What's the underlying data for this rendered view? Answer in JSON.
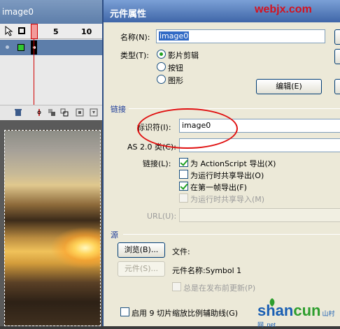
{
  "timeline": {
    "title": "image0",
    "ruler": [
      "1",
      "5",
      "10"
    ]
  },
  "dialog": {
    "title": "元件属性",
    "watermark_top": "webjx.com",
    "name_label": "名称(N):",
    "name_value": "image0",
    "type_label": "类型(T):",
    "type_options": [
      "影片剪辑",
      "按钮",
      "图形"
    ],
    "type_selected": "影片剪辑",
    "edit_button": "编辑(E)",
    "linkage_header": "链接",
    "identifier_label": "标识符(I):",
    "identifier_value": "image0",
    "as_class_label": "AS 2.0 类(C):",
    "as_class_value": "",
    "linkage_label": "链接(L):",
    "linkage_options": [
      {
        "label": "为 ActionScript 导出(X)",
        "checked": true,
        "enabled": true
      },
      {
        "label": "为运行时共享导出(O)",
        "checked": false,
        "enabled": true
      },
      {
        "label": "在第一帧导出(F)",
        "checked": true,
        "enabled": true
      },
      {
        "label": "为运行时共享导入(M)",
        "checked": false,
        "enabled": false
      }
    ],
    "url_label": "URL(U):",
    "url_value": "",
    "source_header": "源",
    "browse_button": "浏览(B)...",
    "file_label": "文件:",
    "symbol_button": "元件(S)...",
    "symbol_name_label": "元件名称:Symbol 1",
    "always_update_label": "总是在发布前更新(P)",
    "guides_label": "启用 9 切片缩放比例辅助线(G)"
  },
  "watermark_bottom": {
    "part1": "shan",
    "part2": "cun",
    "part3": "山村网",
    "suffix": ".net"
  },
  "colors": {
    "title_bar": "#3f66a8",
    "dialog_bg": "#ece9d8",
    "ellipse": "#e01010",
    "watermark_red": "#d4121f"
  }
}
